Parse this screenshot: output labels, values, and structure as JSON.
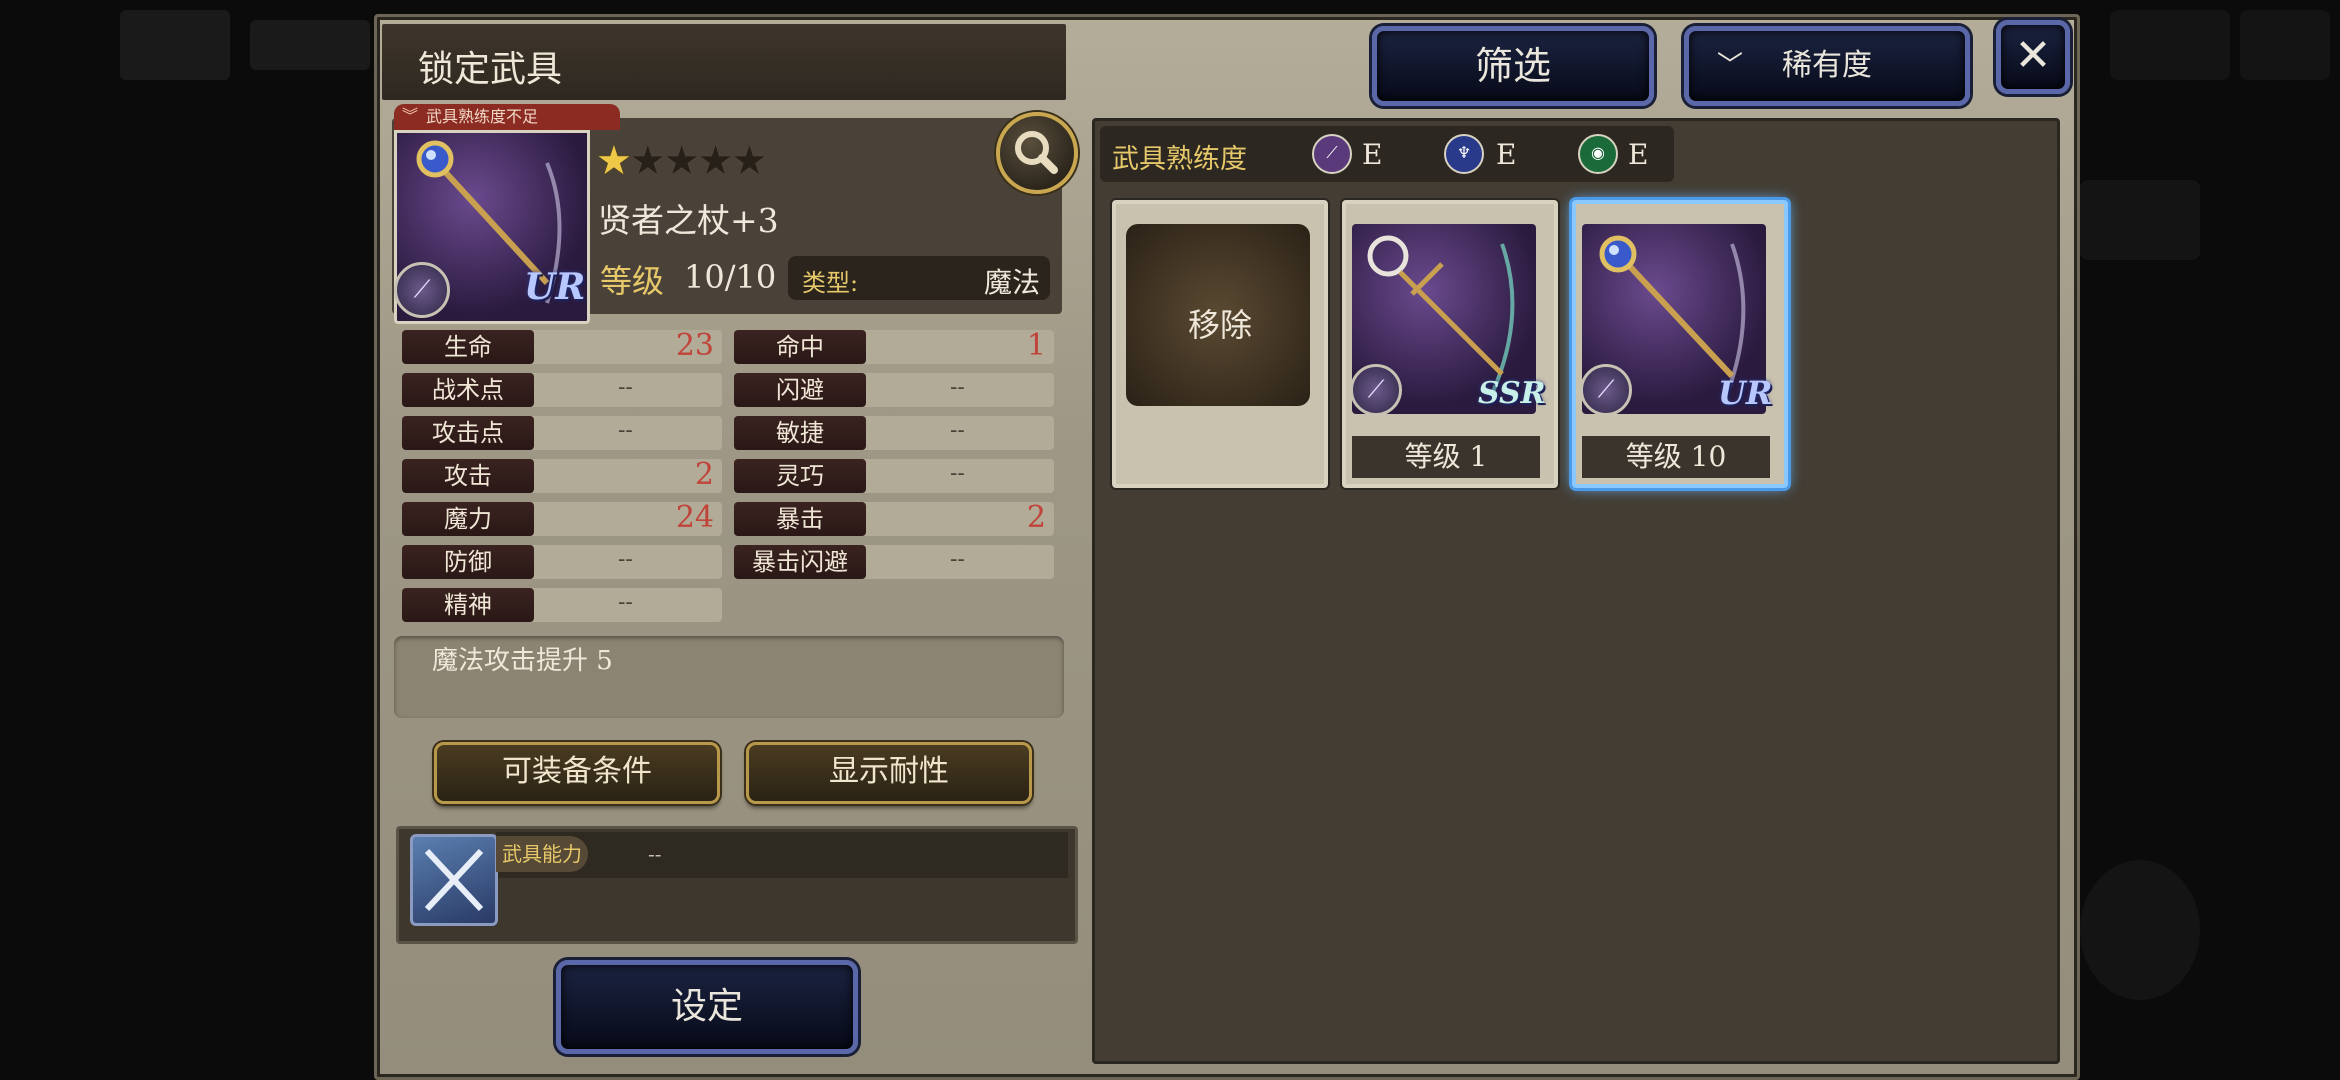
{
  "header": {
    "title": "锁定武具",
    "filter_label": "筛选",
    "sort_label": "稀有度",
    "close_label": "✕"
  },
  "weapon": {
    "warning": "武具熟练度不足",
    "name": "贤者之杖+3",
    "rarity": "UR",
    "stars_filled": 1,
    "stars_total": 5,
    "level_label": "等级",
    "level_value": "10/10",
    "type_label": "类型:",
    "type_value": "魔法"
  },
  "stats_left": [
    {
      "name": "生命",
      "value": "23"
    },
    {
      "name": "战术点",
      "value": "--"
    },
    {
      "name": "攻击点",
      "value": "--"
    },
    {
      "name": "攻击",
      "value": "2"
    },
    {
      "name": "魔力",
      "value": "24"
    },
    {
      "name": "防御",
      "value": "--"
    },
    {
      "name": "精神",
      "value": "--"
    }
  ],
  "stats_right": [
    {
      "name": "命中",
      "value": "1"
    },
    {
      "name": "闪避",
      "value": "--"
    },
    {
      "name": "敏捷",
      "value": "--"
    },
    {
      "name": "灵巧",
      "value": "--"
    },
    {
      "name": "暴击",
      "value": "2"
    },
    {
      "name": "暴击闪避",
      "value": "--"
    }
  ],
  "effect": "魔法攻击提升 5",
  "buttons": {
    "equip_conditions": "可装备条件",
    "show_resistance": "显示耐性",
    "set": "设定"
  },
  "ability": {
    "label": "武具能力",
    "value": "--"
  },
  "proficiency": {
    "label": "武具熟练度",
    "grades": [
      {
        "icon": "sword-icon",
        "grade": "E"
      },
      {
        "icon": "staff-icon",
        "grade": "E"
      },
      {
        "icon": "shield-icon",
        "grade": "E"
      }
    ]
  },
  "cards": [
    {
      "type": "remove",
      "label": "移除"
    },
    {
      "type": "weapon",
      "rarity": "SSR",
      "level": "等级 1"
    },
    {
      "type": "weapon",
      "rarity": "UR",
      "level": "等级 10",
      "selected": true
    }
  ],
  "colors": {
    "panel": "#a39c8a",
    "accent_gold": "#e6c86a",
    "stat_red": "#c0443a",
    "button_blue_border": "#5a67a8",
    "selected_glow": "#4a9ae8"
  }
}
